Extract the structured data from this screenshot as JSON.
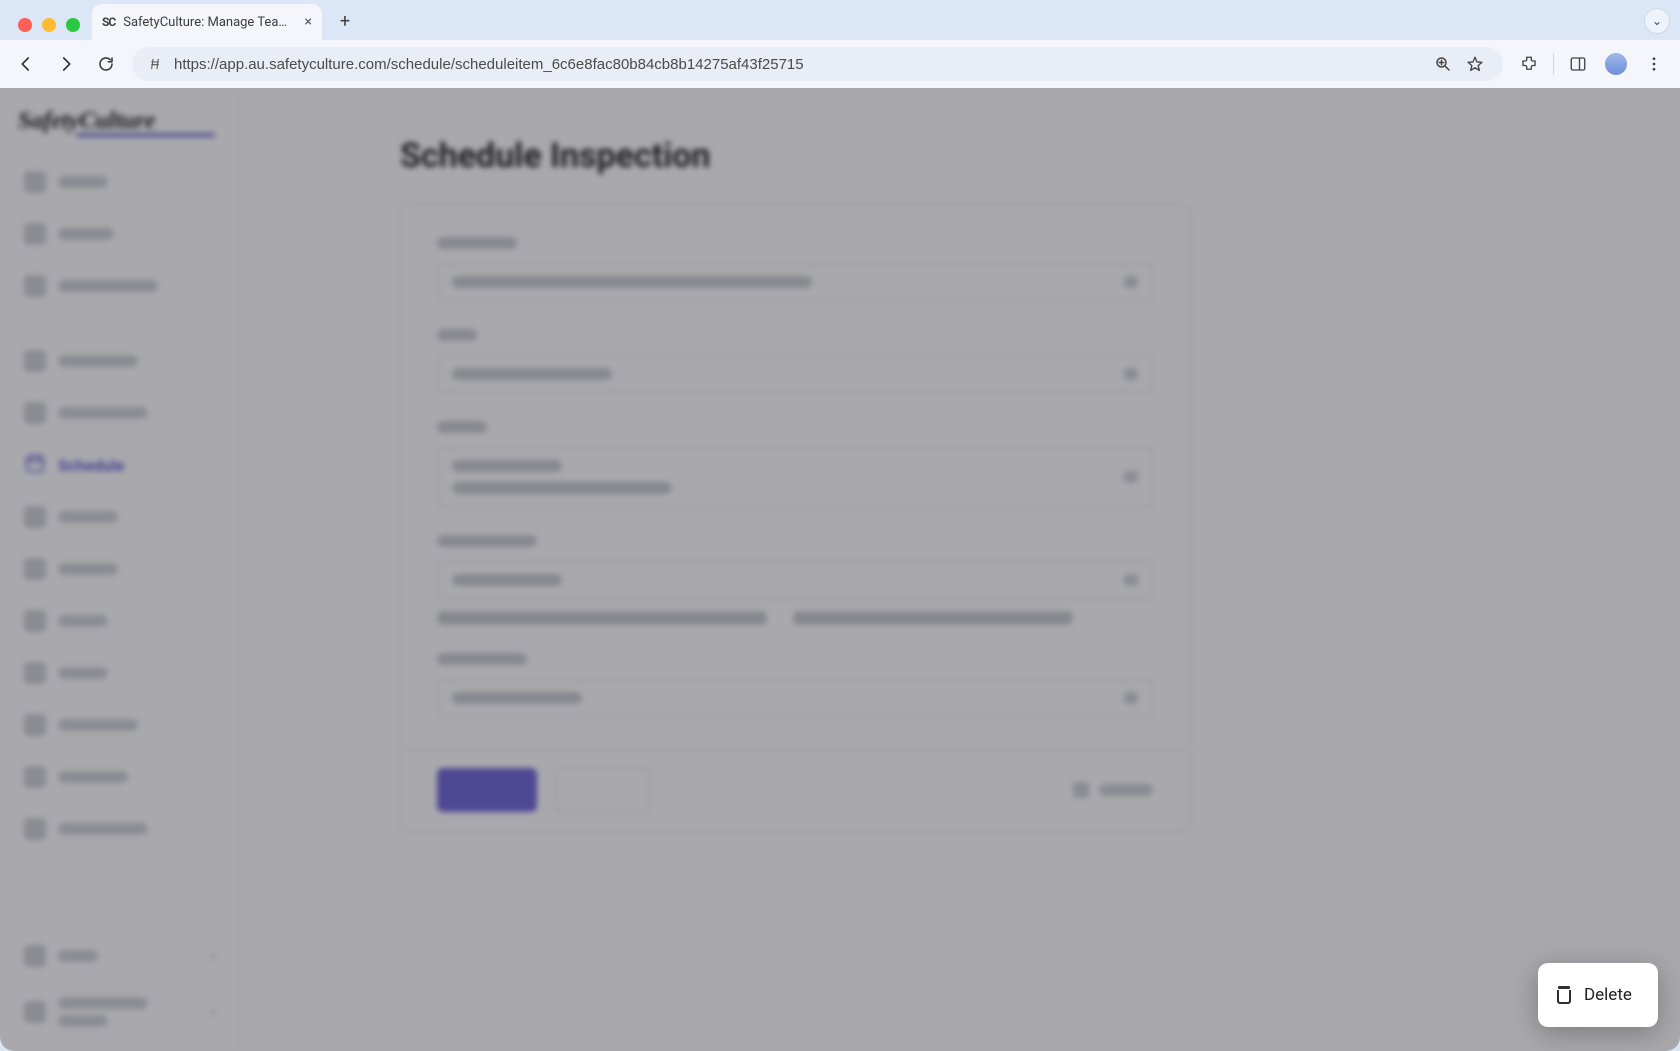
{
  "browser": {
    "tab_title": "SafetyCulture: Manage Teams and…",
    "url": "https://app.au.safetyculture.com/schedule/scheduleitem_6c6e8fac80b84cb8b14275af43f25715"
  },
  "app": {
    "brand": "SafetyCulture",
    "sidebar": {
      "active_label": "Schedule"
    },
    "page": {
      "title": "Schedule Inspection"
    },
    "popover": {
      "delete_label": "Delete"
    }
  }
}
